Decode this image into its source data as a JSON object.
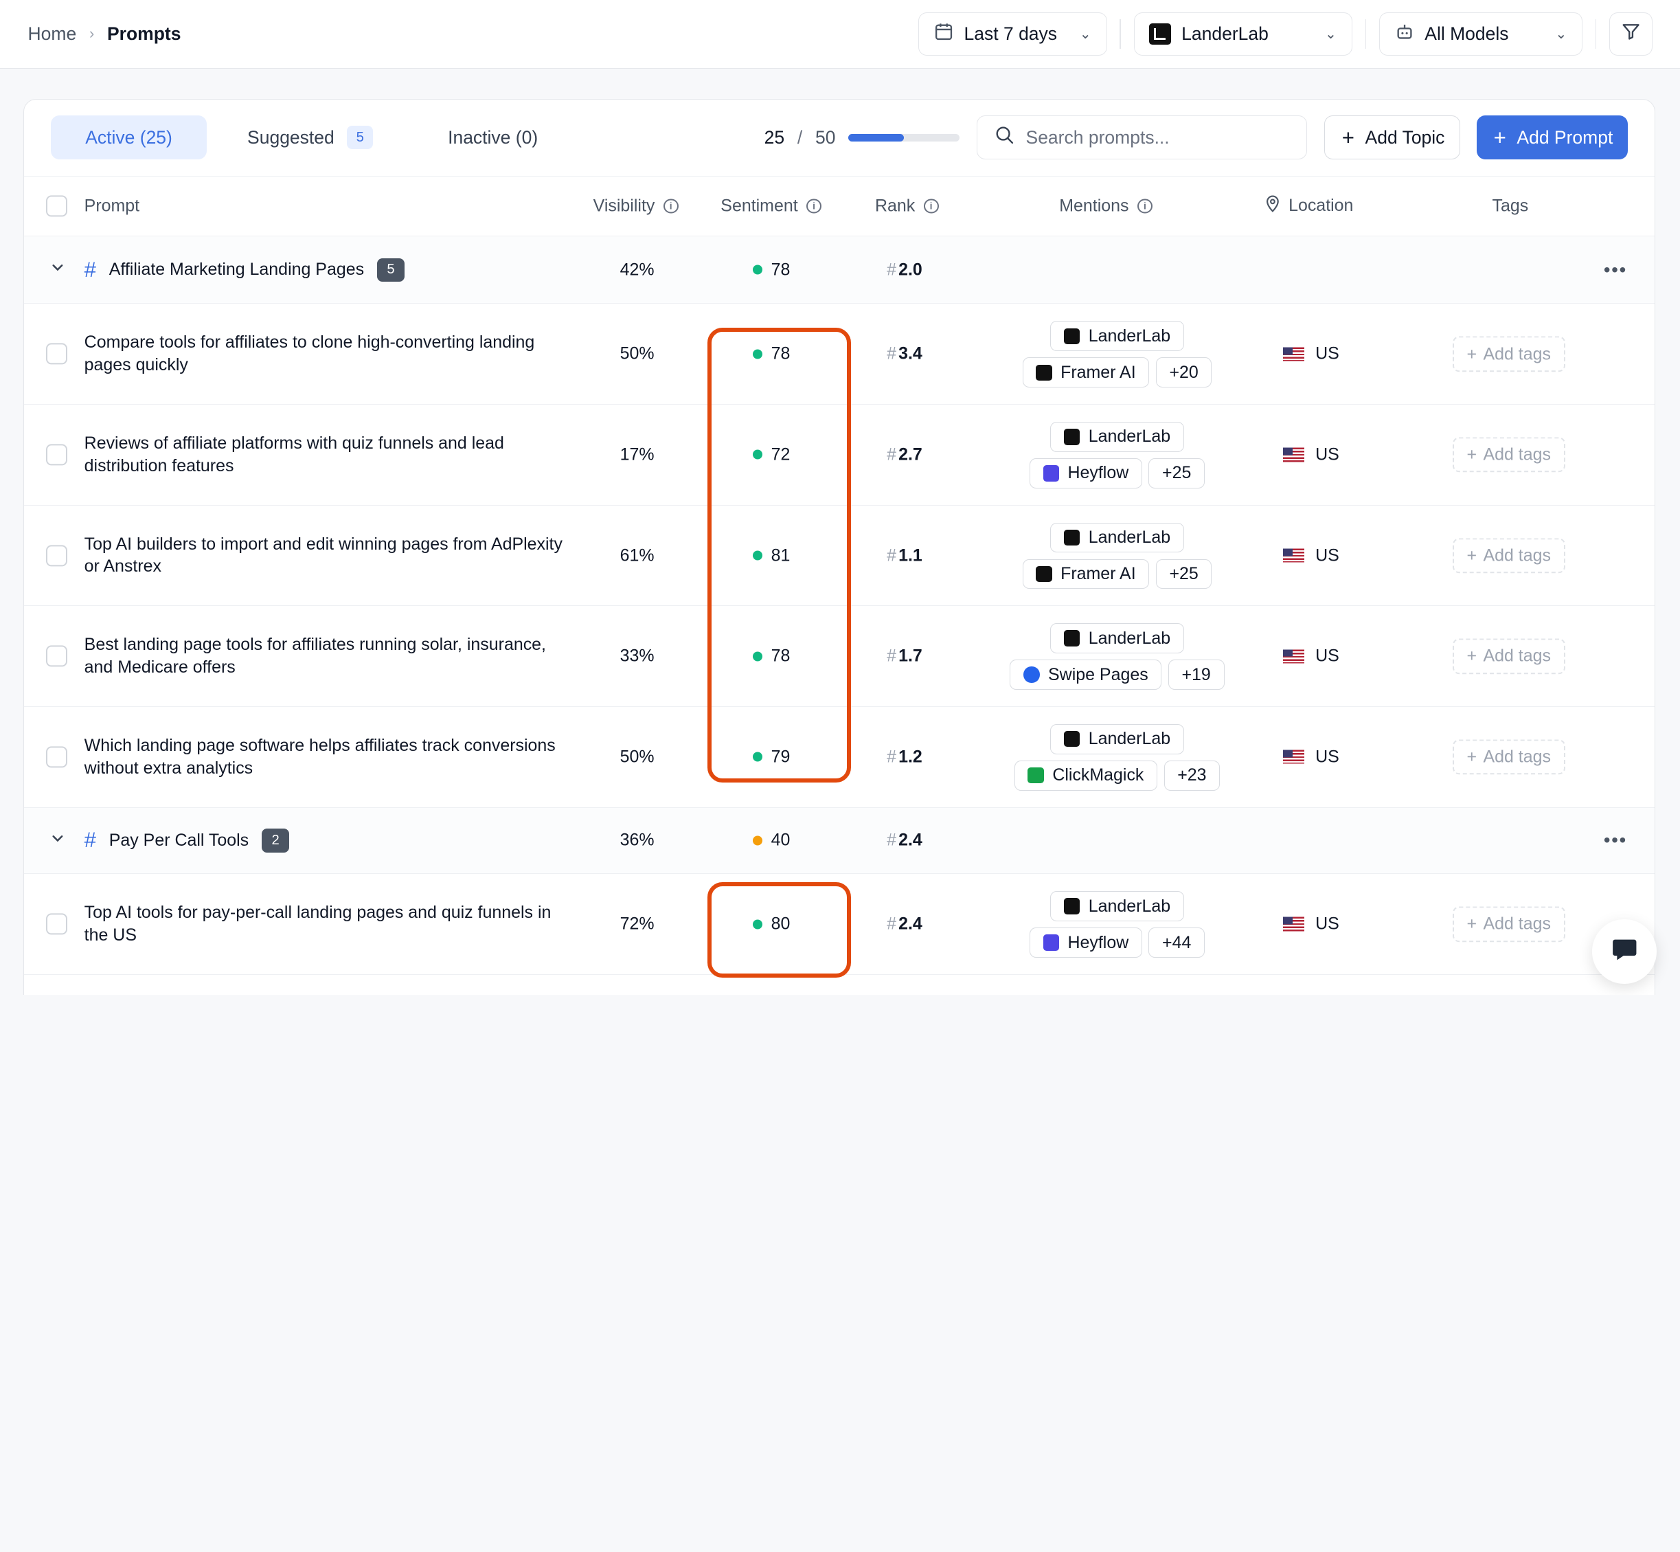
{
  "breadcrumb": {
    "home": "Home",
    "current": "Prompts"
  },
  "filters": {
    "date_range": "Last 7 days",
    "brand": "LanderLab",
    "models": "All Models"
  },
  "tabs": {
    "active": "Active (25)",
    "suggested": "Suggested",
    "suggested_count": "5",
    "inactive": "Inactive (0)"
  },
  "quota": {
    "used": "25",
    "separator": "/",
    "limit": "50",
    "fraction": 0.5
  },
  "search": {
    "placeholder": "Search prompts..."
  },
  "buttons": {
    "add_topic": "Add Topic",
    "add_prompt": "Add Prompt"
  },
  "columns": {
    "prompt": "Prompt",
    "visibility": "Visibility",
    "sentiment": "Sentiment",
    "rank": "Rank",
    "mentions": "Mentions",
    "location": "Location",
    "tags": "Tags"
  },
  "groups": [
    {
      "title": "Affiliate Marketing Landing Pages",
      "count": "5",
      "visibility": "42%",
      "sentiment": "78",
      "rank": "2.0",
      "rows": [
        {
          "prompt": "Compare tools for affiliates to clone high-converting landing pages quickly",
          "visibility": "50%",
          "sentiment": "78",
          "rank": "3.4",
          "mention_top": "LanderLab",
          "mention_2": "Framer AI",
          "mention_more": "+20",
          "location": "US",
          "tags": "Add tags"
        },
        {
          "prompt": "Reviews of affiliate platforms with quiz funnels and lead distribution features",
          "visibility": "17%",
          "sentiment": "72",
          "rank": "2.7",
          "mention_top": "LanderLab",
          "mention_2": "Heyflow",
          "mention_more": "+25",
          "location": "US",
          "tags": "Add tags"
        },
        {
          "prompt": "Top AI builders to import and edit winning pages from AdPlexity or Anstrex",
          "visibility": "61%",
          "sentiment": "81",
          "rank": "1.1",
          "mention_top": "LanderLab",
          "mention_2": "Framer AI",
          "mention_more": "+25",
          "location": "US",
          "tags": "Add tags"
        },
        {
          "prompt": "Best landing page tools for affiliates running solar, insurance, and Medicare offers",
          "visibility": "33%",
          "sentiment": "78",
          "rank": "1.7",
          "mention_top": "LanderLab",
          "mention_2": "Swipe Pages",
          "mention_more": "+19",
          "location": "US",
          "tags": "Add tags"
        },
        {
          "prompt": "Which landing page software helps affiliates track conversions without extra analytics",
          "visibility": "50%",
          "sentiment": "79",
          "rank": "1.2",
          "mention_top": "LanderLab",
          "mention_2": "ClickMagick",
          "mention_more": "+23",
          "location": "US",
          "tags": "Add tags"
        }
      ]
    },
    {
      "title": "Pay Per Call Tools",
      "count": "2",
      "visibility": "36%",
      "sentiment": "40",
      "rank": "2.4",
      "rows": [
        {
          "prompt": "Top AI tools for pay-per-call landing pages and quiz funnels in the US",
          "visibility": "72%",
          "sentiment": "80",
          "rank": "2.4",
          "mention_top": "LanderLab",
          "mention_2": "Heyflow",
          "mention_more": "+44",
          "location": "US",
          "tags": "Add tags"
        }
      ]
    }
  ],
  "colors": {
    "accent": "#3b6fe0",
    "sentiment_positive": "#10b981",
    "sentiment_neutral": "#f59e0b",
    "highlight": "#e2490d"
  }
}
